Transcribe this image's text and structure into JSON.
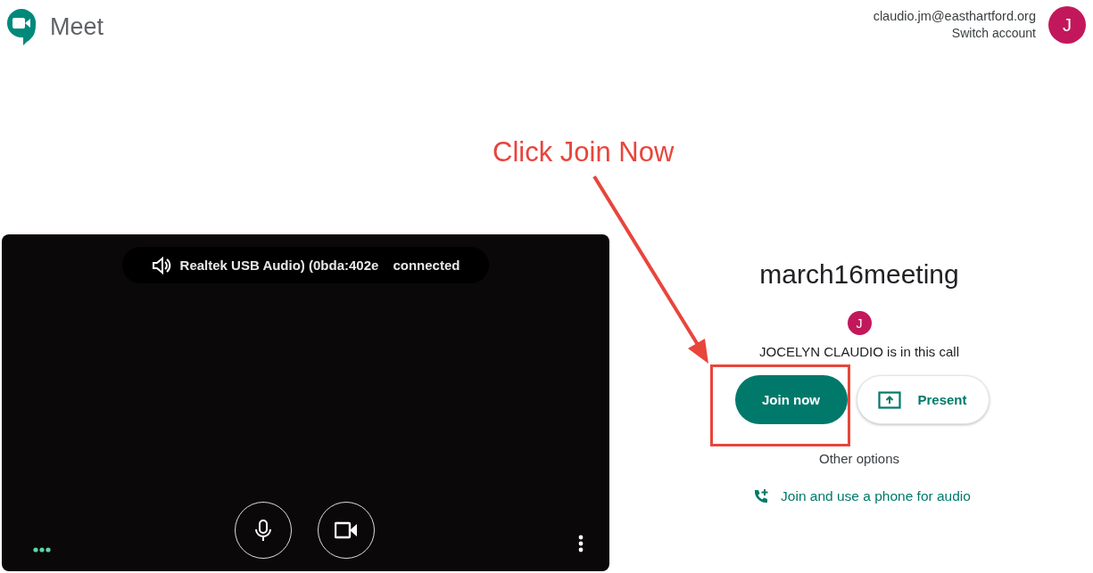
{
  "header": {
    "app_name": "Meet",
    "account": {
      "email": "claudio.jm@easthartford.org",
      "switch_label": "Switch account",
      "avatar_initial": "J"
    }
  },
  "preview": {
    "audio_status": {
      "device": "Realtek USB Audio) (0bda:402e",
      "status": "connected"
    },
    "mic_on": true,
    "camera_on": true
  },
  "meeting": {
    "name": "march16meeting",
    "participant_initial": "J",
    "participant_text": "JOCELYN CLAUDIO is in this call",
    "buttons": [
      {
        "kind": "primary",
        "label": "Join now"
      },
      {
        "kind": "present",
        "label": "Present"
      }
    ],
    "other_options": "Other options",
    "phone_link": "Join and use a phone for audio"
  },
  "annotation": {
    "text": "Click Join Now"
  }
}
